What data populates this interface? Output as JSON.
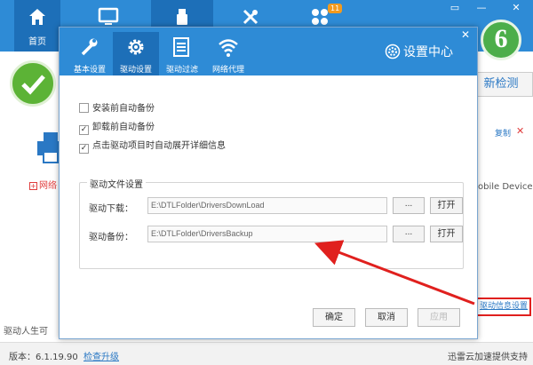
{
  "app": {
    "nav": [
      {
        "label": "首页",
        "icon": "home-icon"
      },
      {
        "label": "",
        "icon": "monitor-icon"
      },
      {
        "label": "",
        "icon": "usb-icon"
      },
      {
        "label": "",
        "icon": "tools-icon"
      },
      {
        "label": "",
        "icon": "apps-icon",
        "badge": "11"
      }
    ],
    "window_controls": [
      "▭",
      "—",
      "✕"
    ],
    "logo_text": "6",
    "redetect_label": "新检测",
    "copy_label": "复制",
    "copy_close": "✕",
    "network_item_label": "网络",
    "network_item_prefix": "+",
    "device_text": "obile Device",
    "slogan_text": "驱动人生可",
    "driver_info_link": "驱动信息设置",
    "status": {
      "version": "版本：6.1.19.90",
      "check_update": "检查升级",
      "support": "迅雷云加速提供支持"
    },
    "colors": {
      "header": "#2e8bd6",
      "active_tab": "#1d6fb8",
      "highlight": "#e0201e",
      "link": "#2a78c4"
    }
  },
  "dialog": {
    "title": "设置中心",
    "close": "✕",
    "tabs": [
      {
        "label": "基本设置",
        "icon": "wrench-icon",
        "active": false
      },
      {
        "label": "驱动设置",
        "icon": "gear-icon",
        "active": true
      },
      {
        "label": "驱动过滤",
        "icon": "list-icon",
        "active": false
      },
      {
        "label": "网络代理",
        "icon": "wifi-icon",
        "active": false
      }
    ],
    "options": [
      {
        "label": "安装前自动备份",
        "checked": false,
        "mark": ""
      },
      {
        "label": "卸载前自动备份",
        "checked": true,
        "mark": "✓"
      },
      {
        "label": "点击驱动项目时自动展开详细信息",
        "checked": true,
        "mark": "✓"
      }
    ],
    "file_group": {
      "title": "驱动文件设置",
      "download": {
        "label": "驱动下载：",
        "value": "E:\\DTLFolder\\DriversDownLoad",
        "browse": "...",
        "open": "打开"
      },
      "backup": {
        "label": "驱动备份：",
        "value": "E:\\DTLFolder\\DriversBackup",
        "browse": "...",
        "open": "打开"
      }
    },
    "buttons": {
      "ok": "确定",
      "cancel": "取消",
      "apply": "应用"
    }
  }
}
